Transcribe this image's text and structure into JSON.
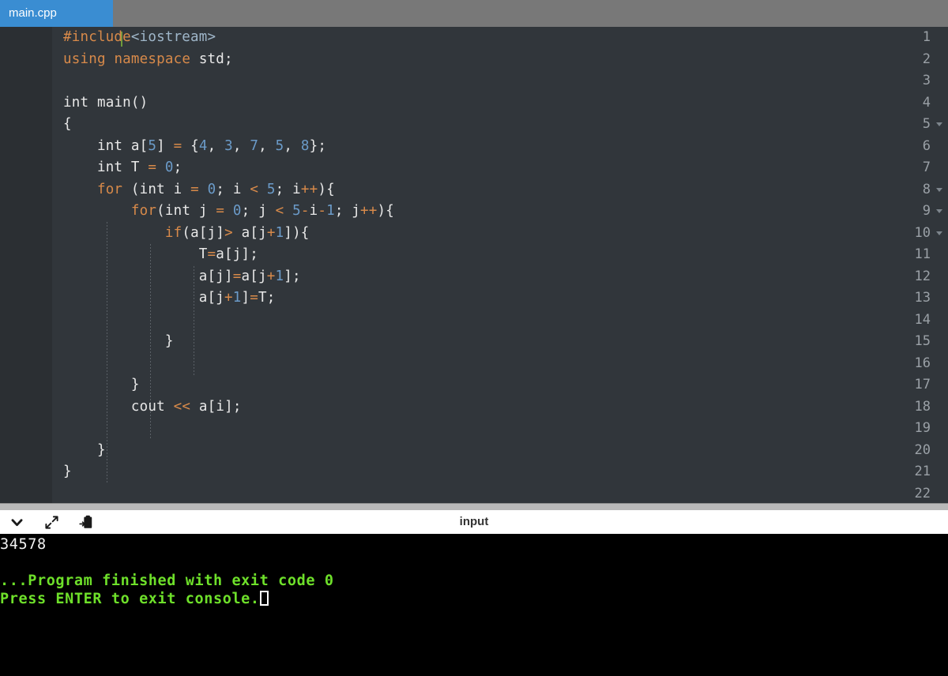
{
  "window": {
    "accent_blue": "#3a8dd2",
    "top_strip_orange": "#f0a028",
    "editor_bg": "#31363b",
    "gutter_bg": "#2b2f33",
    "console_bg": "#000000",
    "console_green": "#6ee02a"
  },
  "tabbar": {
    "active_tab": "main.cpp"
  },
  "editor": {
    "language": "cpp",
    "line_numbers": [
      "1",
      "2",
      "3",
      "4",
      "5",
      "6",
      "7",
      "8",
      "9",
      "10",
      "11",
      "12",
      "13",
      "14",
      "15",
      "16",
      "17",
      "18",
      "19",
      "20",
      "21",
      "22"
    ],
    "folded_lines": [
      "5",
      "8",
      "9",
      "10"
    ],
    "lines": [
      {
        "n": "1",
        "text": "#include<iostream>"
      },
      {
        "n": "2",
        "text": "using namespace std;"
      },
      {
        "n": "3",
        "text": ""
      },
      {
        "n": "4",
        "text": "int main()"
      },
      {
        "n": "5",
        "text": "{"
      },
      {
        "n": "6",
        "text": "    int a[5] = {4, 3, 7, 5, 8};"
      },
      {
        "n": "7",
        "text": "    int T = 0;"
      },
      {
        "n": "8",
        "text": "    for (int i = 0; i < 5; i++){"
      },
      {
        "n": "9",
        "text": "        for(int j = 0; j < 5-i-1; j++){"
      },
      {
        "n": "10",
        "text": "            if(a[j]> a[j+1]){"
      },
      {
        "n": "11",
        "text": "                T=a[j];"
      },
      {
        "n": "12",
        "text": "                a[j]=a[j+1];"
      },
      {
        "n": "13",
        "text": "                a[j+1]=T;"
      },
      {
        "n": "14",
        "text": ""
      },
      {
        "n": "15",
        "text": "            }"
      },
      {
        "n": "16",
        "text": ""
      },
      {
        "n": "17",
        "text": "        }"
      },
      {
        "n": "18",
        "text": "        cout << a[i];"
      },
      {
        "n": "19",
        "text": ""
      },
      {
        "n": "20",
        "text": "    }"
      },
      {
        "n": "21",
        "text": "}"
      },
      {
        "n": "22",
        "text": ""
      }
    ]
  },
  "console_toolbar": {
    "icons": [
      "chevron-down-icon",
      "expand-icon",
      "paste-clipboard-icon"
    ],
    "input_label": "input"
  },
  "console": {
    "output_line": "34578",
    "finished_line": "...Program finished with exit code 0",
    "prompt_line": "Press ENTER to exit console.",
    "exit_code": "0"
  }
}
